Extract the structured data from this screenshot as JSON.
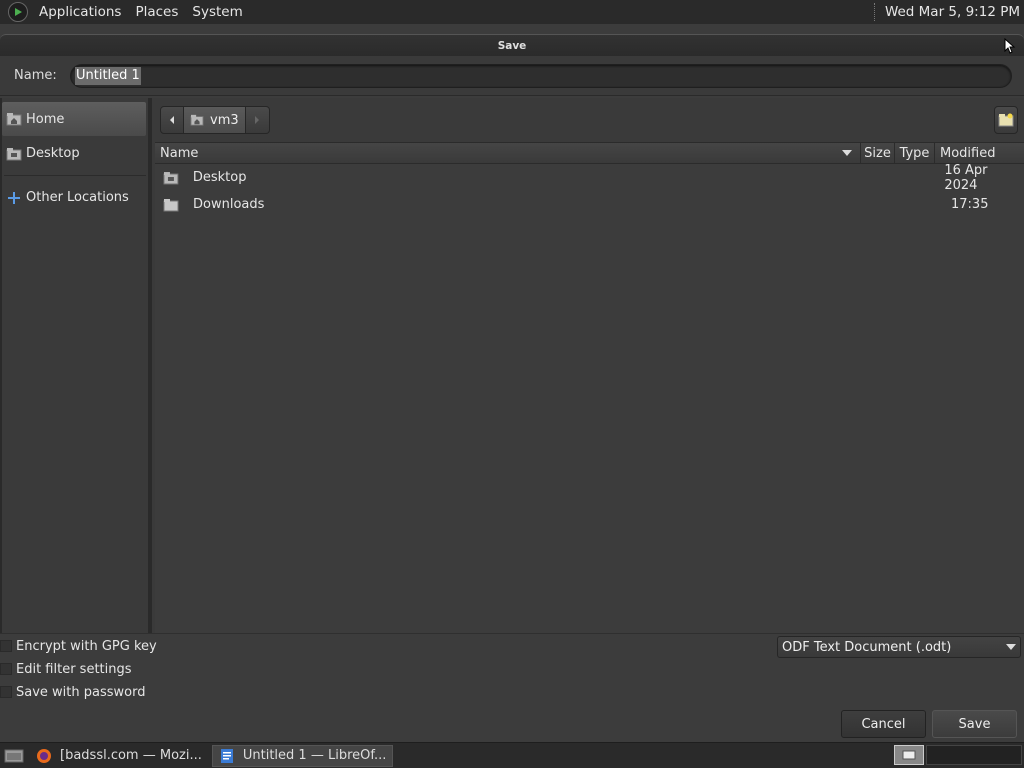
{
  "top_panel": {
    "menus": [
      "Applications",
      "Places",
      "System"
    ],
    "clock": "Wed Mar  5,  9:12 PM"
  },
  "dialog": {
    "title": "Save",
    "name_label": "Name:",
    "name_value": "Untitled 1"
  },
  "sidebar": {
    "items": [
      {
        "label": "Home",
        "icon": "home-folder-icon"
      },
      {
        "label": "Desktop",
        "icon": "desktop-folder-icon"
      },
      {
        "label": "Other Locations",
        "icon": "plus-icon"
      }
    ]
  },
  "pathbar": {
    "crumb": "vm3"
  },
  "list": {
    "columns": {
      "name": "Name",
      "size": "Size",
      "type": "Type",
      "modified": "Modified"
    },
    "rows": [
      {
        "name": "Desktop",
        "modified": "16 Apr 2024",
        "icon": "desktop-folder-icon"
      },
      {
        "name": "Downloads",
        "modified": "17:35",
        "icon": "folder-icon"
      }
    ]
  },
  "options": {
    "encrypt": "Encrypt with GPG key",
    "edit_filter": "Edit filter settings",
    "save_password": "Save with password",
    "filter_value": "ODF Text Document (.odt)"
  },
  "buttons": {
    "cancel": "Cancel",
    "save": "Save"
  },
  "taskbar": {
    "tasks": [
      "[badssl.com — Mozi...",
      "Untitled 1 — LibreOf..."
    ]
  }
}
